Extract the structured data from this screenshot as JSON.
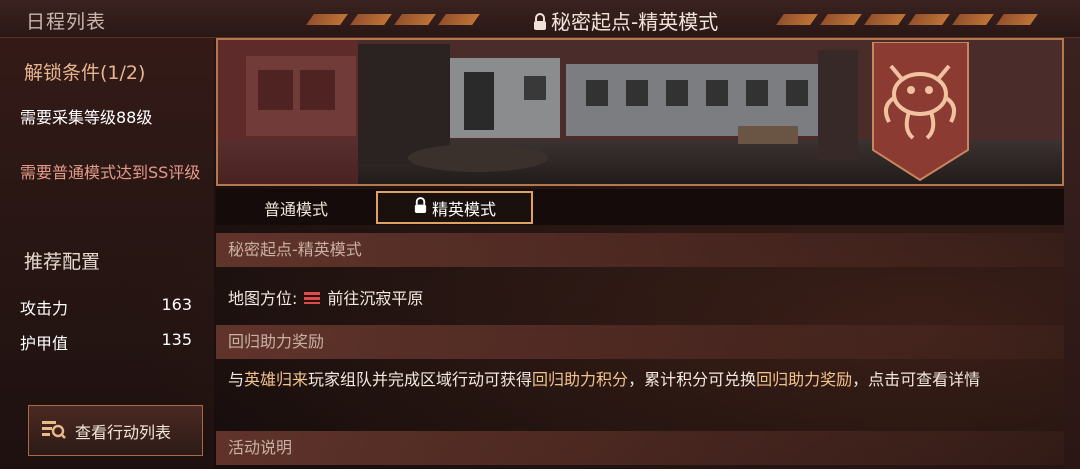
{
  "topbar": {
    "left_title": "日程列表",
    "center_title": "秘密起点-精英模式",
    "lock_icon": "lock-icon"
  },
  "left": {
    "unlock_title": "解锁条件(1/2)",
    "requirement_1": "需要采集等级88级",
    "requirement_2": "需要普通模式达到SS评级",
    "recommend_title": "推荐配置",
    "stats": [
      {
        "label": "攻击力",
        "value": "163"
      },
      {
        "label": "护甲值",
        "value": "135"
      }
    ],
    "action_button": "查看行动列表"
  },
  "main": {
    "tabs": [
      {
        "label": "普通模式"
      },
      {
        "label": "精英模式"
      }
    ],
    "section1_title": "秘密起点-精英模式",
    "map_label": "地图方位:",
    "map_destination": "前往沉寂平原",
    "section2_title": "回归助力奖励",
    "reward_text": {
      "p1": "与",
      "h1": "英雄归来",
      "p2": "玩家组队并完成区域行动可获得",
      "h2": "回归助力积分",
      "p3": "，累计积分可兑换",
      "h3": "回归助力奖励",
      "p4": "，点击可查看详情"
    },
    "section3_title": "活动说明"
  },
  "colors": {
    "accent": "#e0a162",
    "highlight": "#f2c38d",
    "warning": "#e59a8a"
  }
}
